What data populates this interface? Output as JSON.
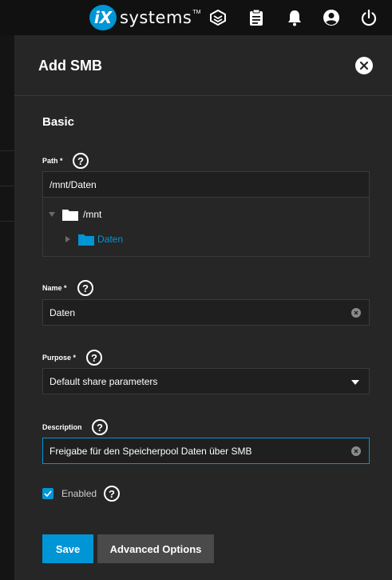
{
  "topbar": {
    "logo_badge": "iX",
    "logo_text": "systems",
    "logo_tm": "TM",
    "icons": [
      "truecommand-icon",
      "clipboard-icon",
      "bell-icon",
      "account-icon",
      "power-icon"
    ]
  },
  "panel": {
    "title": "Add SMB",
    "section": "Basic"
  },
  "path": {
    "label": "Path *",
    "value": "/mnt/Daten",
    "tree": [
      {
        "name": "/mnt",
        "expanded": true
      },
      {
        "name": "Daten",
        "expanded": false,
        "selected": true
      }
    ]
  },
  "name": {
    "label": "Name *",
    "value": "Daten"
  },
  "purpose": {
    "label": "Purpose *",
    "value": "Default share parameters"
  },
  "description": {
    "label": "Description",
    "value": "Freigabe für den Speicherpool Daten über SMB"
  },
  "enabled": {
    "label": "Enabled",
    "checked": true
  },
  "actions": {
    "save": "Save",
    "advanced": "Advanced Options"
  },
  "colors": {
    "accent": "#0095d5",
    "panel": "#262626",
    "topbar": "#111111"
  }
}
